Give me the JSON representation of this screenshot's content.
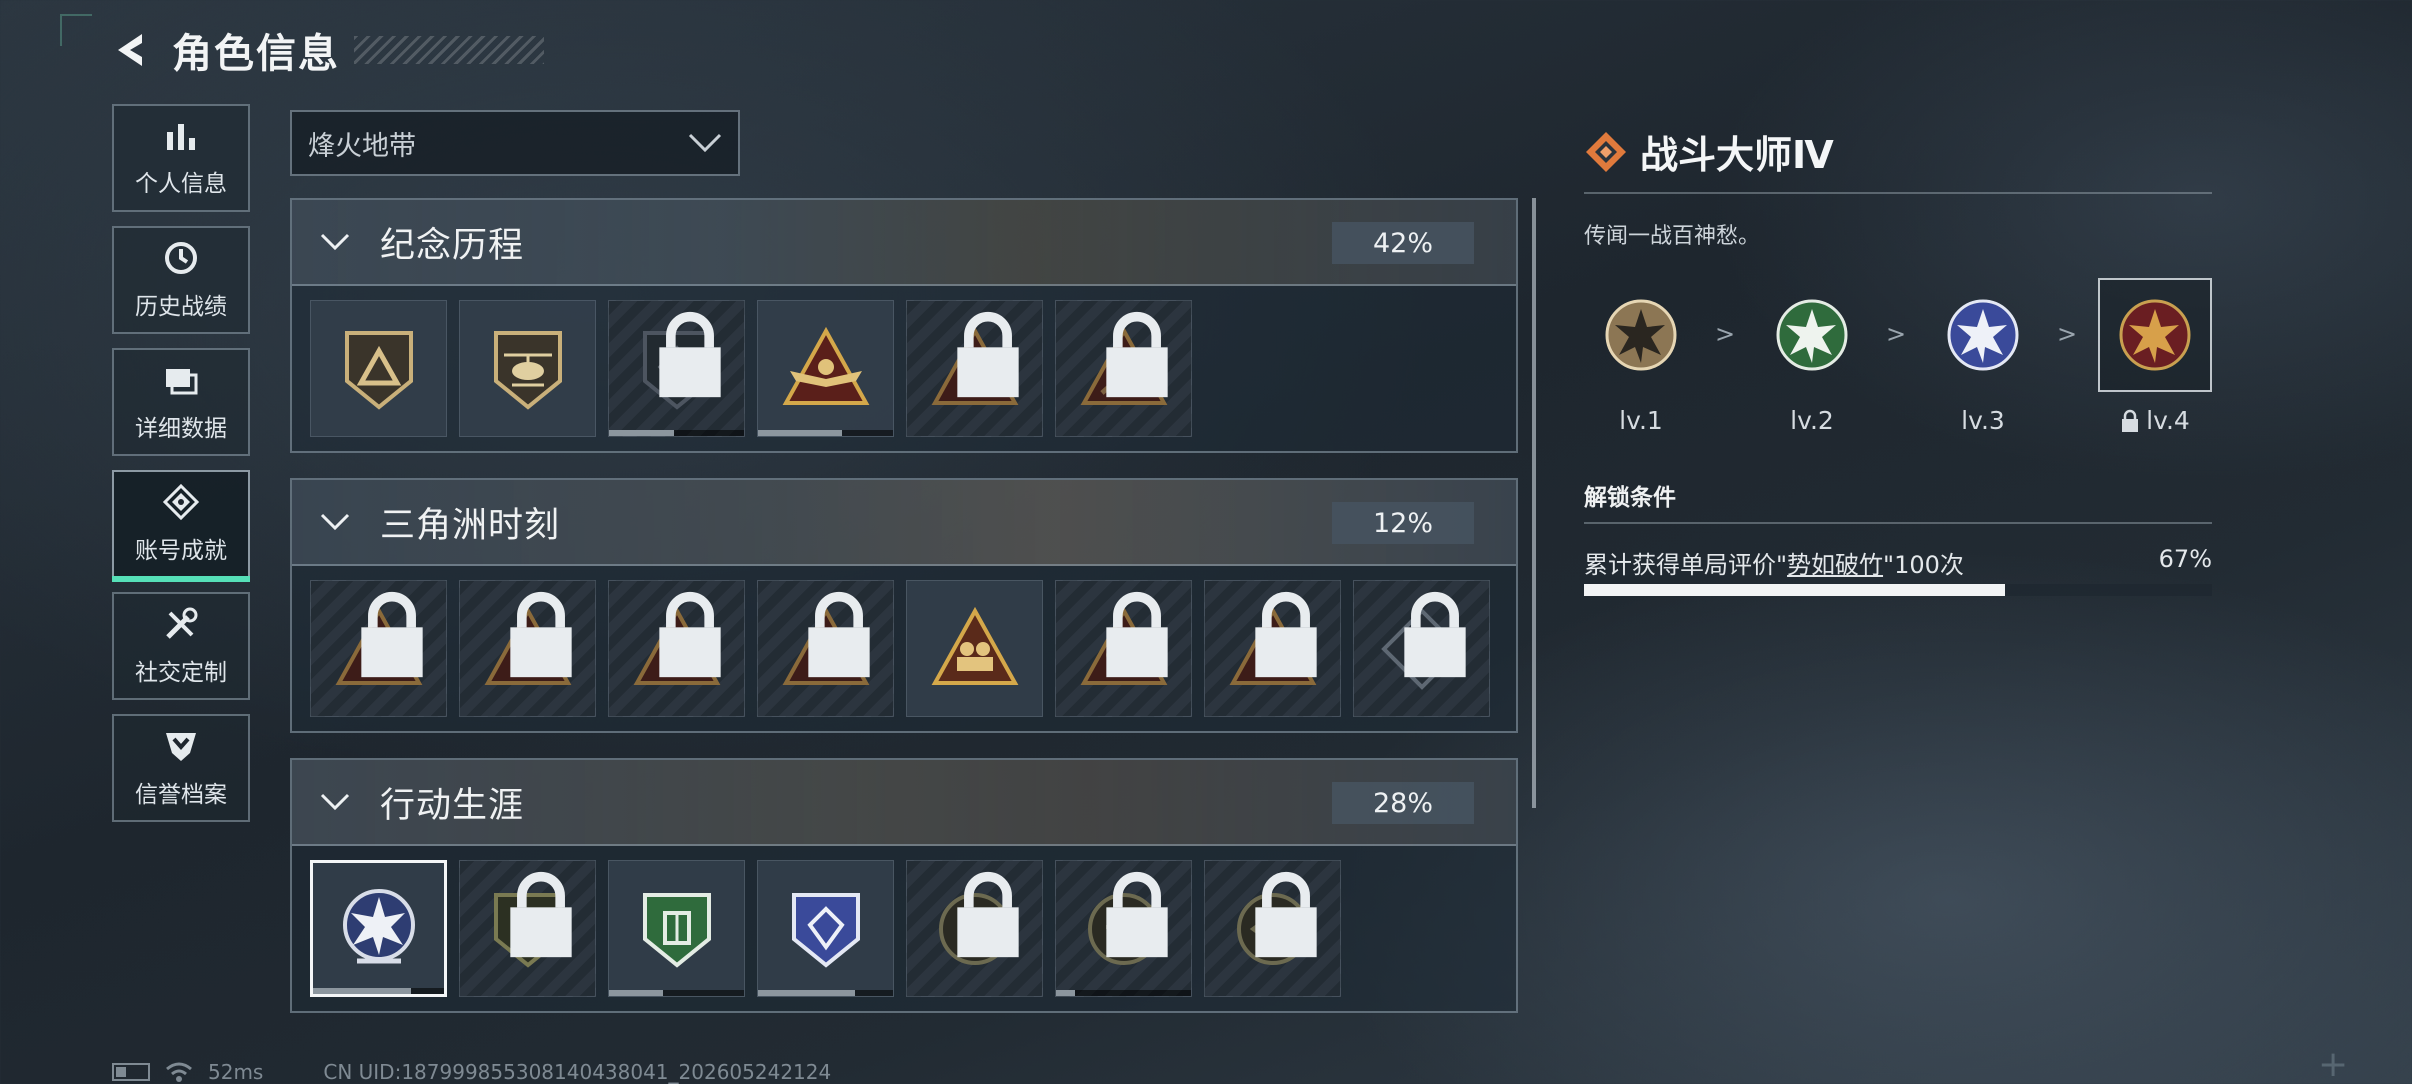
{
  "header": {
    "title": "角色信息"
  },
  "sidebar": {
    "items": [
      {
        "label": "个人信息",
        "icon": "bar-chart-icon"
      },
      {
        "label": "历史战绩",
        "icon": "history-clock-icon"
      },
      {
        "label": "详细数据",
        "icon": "cards-icon"
      },
      {
        "label": "账号成就",
        "icon": "achievement-icon",
        "active": true
      },
      {
        "label": "社交定制",
        "icon": "tools-icon"
      },
      {
        "label": "信誉档案",
        "icon": "shield-chevron-icon"
      }
    ]
  },
  "mode_select": {
    "value": "烽火地带"
  },
  "sections": [
    {
      "title": "纪念历程",
      "percent": "42%"
    },
    {
      "title": "三角洲时刻",
      "percent": "12%"
    },
    {
      "title": "行动生涯",
      "percent": "28%"
    }
  ],
  "detail": {
    "title": "战斗大师Ⅳ",
    "description": "传闻一战百神愁。",
    "levels": [
      {
        "label": "lv.1"
      },
      {
        "label": "lv.2"
      },
      {
        "label": "lv.3"
      },
      {
        "label": "lv.4",
        "locked": true
      }
    ],
    "level_separator": ">",
    "unlock_title": "解锁条件",
    "condition": {
      "prefix": "累计获得单局评价\"",
      "highlight": "势如破竹",
      "suffix": "\"100次",
      "percent": "67%",
      "progress": 0.67
    }
  },
  "status_bar": {
    "ping": "52ms",
    "uid": "CN UID:18799985530814043804​1_202605242124"
  },
  "colors": {
    "accent_green": "#56e0b8",
    "accent_orange": "#e07a3c"
  }
}
